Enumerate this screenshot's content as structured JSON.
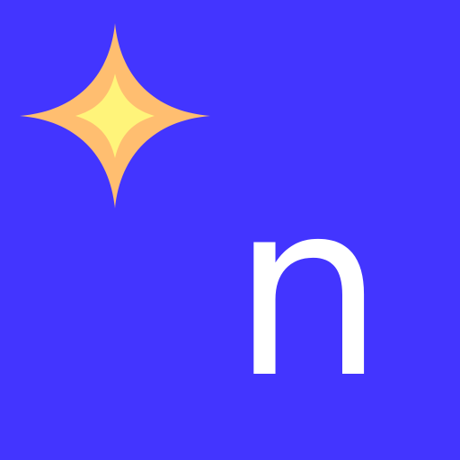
{
  "app_icon": {
    "letter": "n",
    "icon": "sparkle-icon",
    "colors": {
      "background": "#4335ff",
      "letter": "#ffffff",
      "sparkle_outer": "#ffbe70",
      "sparkle_inner": "#fff47a"
    }
  }
}
